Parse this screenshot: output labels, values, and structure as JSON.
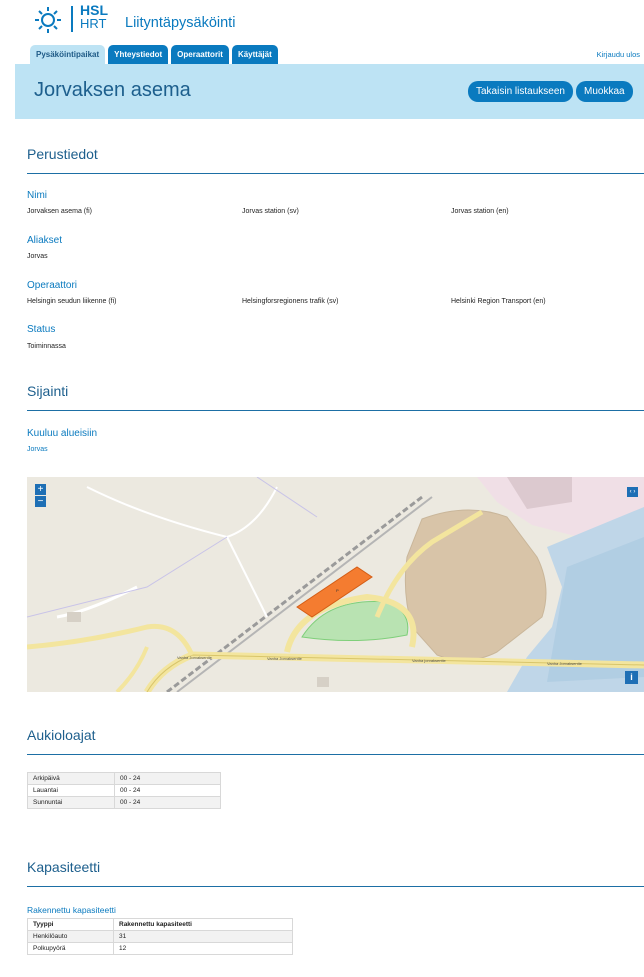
{
  "brand": {
    "hsl": "HSL",
    "hrt": "HRT",
    "app_name": "Liityntäpysäköinti",
    "logo_icon": "hsl-logo-icon",
    "accent_color": "#0a7abf"
  },
  "nav": {
    "tabs": [
      {
        "label": "Pysäköintipaikat",
        "active": true
      },
      {
        "label": "Yhteystiedot",
        "active": false
      },
      {
        "label": "Operaattorit",
        "active": false
      },
      {
        "label": "Käyttäjät",
        "active": false
      }
    ],
    "logout": "Kirjaudu ulos"
  },
  "header": {
    "title": "Jorvaksen asema",
    "back_button": "Takaisin listaukseen",
    "edit_button": "Muokkaa"
  },
  "basic": {
    "section_title": "Perustiedot",
    "name_label": "Nimi",
    "name_fi": "Jorvaksen asema (fi)",
    "name_sv": "Jorvas station (sv)",
    "name_en": "Jorvas station (en)",
    "aliases_label": "Aliakset",
    "aliases_value": "Jorvas",
    "operator_label": "Operaattori",
    "operator_fi": "Helsingin seudun liikenne (fi)",
    "operator_sv": "Helsingforsregionens trafik (sv)",
    "operator_en": "Helsinki Region Transport (en)",
    "status_label": "Status",
    "status_value": "Toiminnassa"
  },
  "location": {
    "section_title": "Sijainti",
    "regions_label": "Kuuluu alueisiin",
    "regions_value": "Jorvas",
    "map": {
      "zoom_in": "+",
      "zoom_out": "−",
      "expand": "‹ ›",
      "info": "i",
      "road_labels": [
        "Vanha Jorvaksentie",
        "Vanha Jorvaksentie",
        "Vanha jorvaksentie",
        "Vanha Jorvaksentie"
      ],
      "parking_marker": "P",
      "parking_color": "#f47c30"
    }
  },
  "hours": {
    "section_title": "Aukioloajat",
    "rows": [
      {
        "day": "Arkipäivä",
        "time": "00 - 24"
      },
      {
        "day": "Lauantai",
        "time": "00 - 24"
      },
      {
        "day": "Sunnuntai",
        "time": "00 - 24"
      }
    ]
  },
  "capacity": {
    "section_title": "Kapasiteetti",
    "built_label": "Rakennettu kapasiteetti",
    "headers": [
      "Tyyppi",
      "Rakennettu kapasiteetti"
    ],
    "rows": [
      {
        "type": "Henkilöauto",
        "value": "31"
      },
      {
        "type": "Polkupyörä",
        "value": "12"
      }
    ]
  }
}
